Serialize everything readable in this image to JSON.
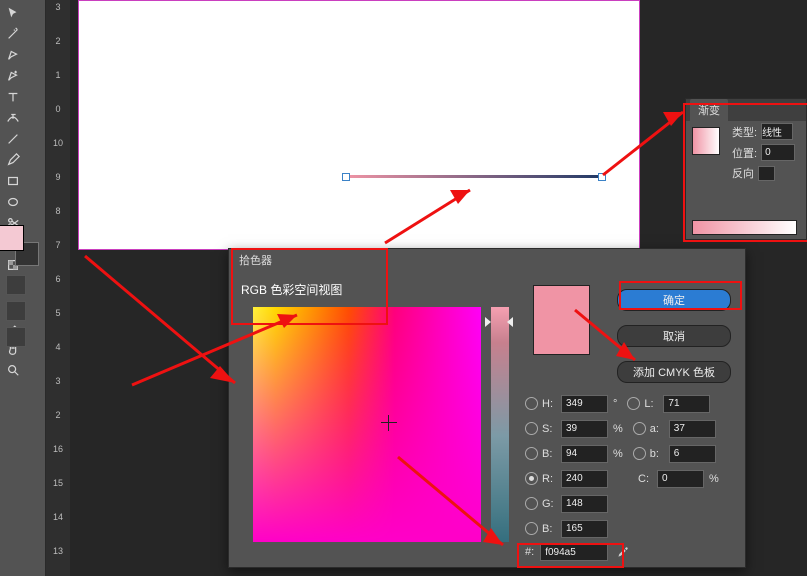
{
  "ruler": {
    "ticks": [
      "3",
      "2",
      "1",
      "0",
      "10",
      "9",
      "8",
      "7",
      "6",
      "5",
      "4",
      "3",
      "2",
      "16",
      "15",
      "14",
      "13"
    ]
  },
  "swatch_fill": "#f4c9d3",
  "gradient": {
    "tab": "渐变",
    "type_label": "类型:",
    "type_value": "线性",
    "position_label": "位置:",
    "position_value": "0",
    "reverse_label": "反向"
  },
  "picker": {
    "title": "拾色器",
    "mode": "RGB 色彩空间视图",
    "ok": "确定",
    "cancel": "取消",
    "addswatch": "添加 CMYK 色板",
    "hsv": {
      "h_label": "H:",
      "h_val": "349",
      "h_unit": "°",
      "s_label": "S:",
      "s_val": "39",
      "s_unit": "%",
      "b_label": "B:",
      "b_val": "94",
      "b_unit": "%"
    },
    "lab": {
      "l_label": "L:",
      "l_val": "71",
      "a_label": "a:",
      "a_val": "37",
      "b_label": "b:",
      "b_val": "6"
    },
    "rgb": {
      "r_label": "R:",
      "r_val": "240",
      "g_label": "G:",
      "g_val": "148",
      "b_label": "B:",
      "b_val": "165"
    },
    "c": {
      "label": "C:",
      "val": "0",
      "unit": "%"
    },
    "hex_label": "#:",
    "hex_val": "f094a5"
  },
  "colors": {
    "accent": "#f094a5",
    "annotation": "#e11"
  }
}
